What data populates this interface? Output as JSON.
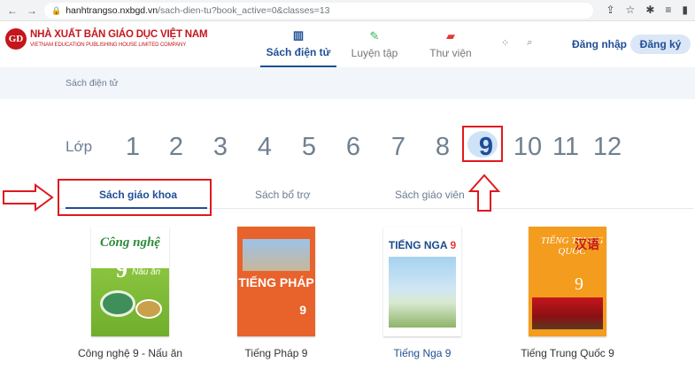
{
  "browser": {
    "url_host": "hanhtrangso.nxbgd.vn",
    "url_path": "/sach-dien-tu?book_active=0&classes=13"
  },
  "header": {
    "logo_line1": "NHÀ XUẤT BẢN GIÁO DỤC VIỆT NAM",
    "logo_line2": "VIETNAM EDUCATION PUBLISHING HOUSE LIMITED COMPANY",
    "logo_badge": "GD",
    "nav": [
      {
        "label": "Sách điện tử",
        "icon": "book-icon",
        "active": true
      },
      {
        "label": "Luyện tập",
        "icon": "pencil-icon",
        "active": false
      },
      {
        "label": "Thư viện",
        "icon": "library-icon",
        "active": false
      }
    ],
    "login": "Đăng nhập",
    "register": "Đăng ký"
  },
  "breadcrumb": "Sách điện tử",
  "grades": {
    "label": "Lớp",
    "items": [
      "1",
      "2",
      "3",
      "4",
      "5",
      "6",
      "7",
      "8",
      "9",
      "10",
      "11",
      "12"
    ],
    "active": "9"
  },
  "tabs": [
    {
      "label": "Sách giáo khoa",
      "active": true
    },
    {
      "label": "Sách bổ trợ",
      "active": false
    },
    {
      "label": "Sách giáo viên",
      "active": false
    }
  ],
  "books": [
    {
      "title": "Công nghệ 9 - Nấu ăn",
      "cover_title": "Công nghệ",
      "cover_num": "9",
      "cover_sub": "Nấu ăn"
    },
    {
      "title": "Tiếng Pháp 9",
      "cover_title": "TIẾNG PHÁP",
      "cover_num": "9"
    },
    {
      "title": "Tiếng Nga 9",
      "cover_title": "TIẾNG NGA",
      "cover_num": "9"
    },
    {
      "title": "Tiếng Trung Quốc 9",
      "cover_title": "TIẾNG TRUNG QUỐC",
      "cover_num": "9",
      "cover_cn": "汉语"
    }
  ],
  "colors": {
    "accent": "#1f4e96",
    "highlight": "#e0191f"
  }
}
